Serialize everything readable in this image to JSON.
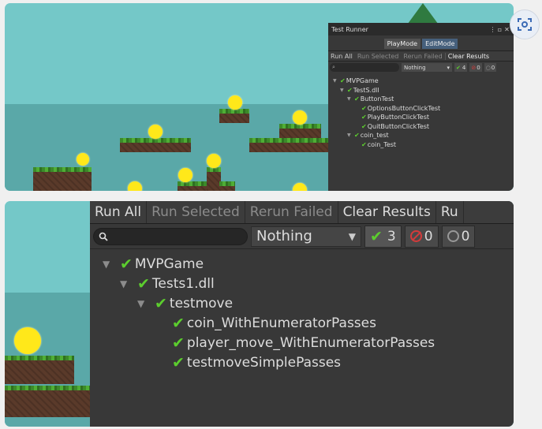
{
  "top_runner": {
    "title": "Test Runner",
    "window_controls": [
      "⋮",
      "▫",
      "✕"
    ],
    "modes": [
      "PlayMode",
      "EditMode"
    ],
    "toolbar": [
      "Run All",
      "Run Selected",
      "Rerun Failed",
      "Clear Results"
    ],
    "filter": {
      "search_icon": "🔍",
      "dropdown": "Nothing",
      "passed": "4",
      "failed": "0",
      "skipped": "0"
    },
    "tree": [
      {
        "label": "MVPGame",
        "level": 0,
        "arrow": true
      },
      {
        "label": "TestS.dll",
        "level": 1,
        "arrow": true
      },
      {
        "label": "ButtonTest",
        "level": 2,
        "arrow": true
      },
      {
        "label": "OptionsButtonClickTest",
        "level": 3,
        "arrow": false
      },
      {
        "label": "PlayButtonClickTest",
        "level": 3,
        "arrow": false
      },
      {
        "label": "QuitButtonClickTest",
        "level": 3,
        "arrow": false
      },
      {
        "label": "coin_test",
        "level": 2,
        "arrow": true
      },
      {
        "label": "coin_Test",
        "level": 3,
        "arrow": false
      }
    ]
  },
  "bottom_runner": {
    "toolbar": [
      "Run All",
      "Run Selected",
      "Rerun Failed",
      "Clear Results",
      "Ru"
    ],
    "filter": {
      "dropdown": "Nothing",
      "passed": "3",
      "failed": "0",
      "skipped": "0"
    },
    "tree": [
      {
        "label": "MVPGame",
        "level": 0,
        "arrow": true
      },
      {
        "label": "Tests1.dll",
        "level": 1,
        "arrow": true
      },
      {
        "label": "testmove",
        "level": 2,
        "arrow": true
      },
      {
        "label": "coin_WithEnumeratorPasses",
        "level": 3,
        "arrow": false
      },
      {
        "label": "player_move_WithEnumeratorPasses",
        "level": 3,
        "arrow": false
      },
      {
        "label": "testmoveSimplePasses",
        "level": 3,
        "arrow": false
      }
    ]
  },
  "icons": {
    "check": "✔",
    "arrow": "▼",
    "scan": "scan-icon"
  },
  "colors": {
    "pass": "#5ccd2e",
    "fail": "#d43b3b",
    "editor_bg": "#383838",
    "sky": "#74c8c8",
    "coin": "#ffe81a"
  }
}
